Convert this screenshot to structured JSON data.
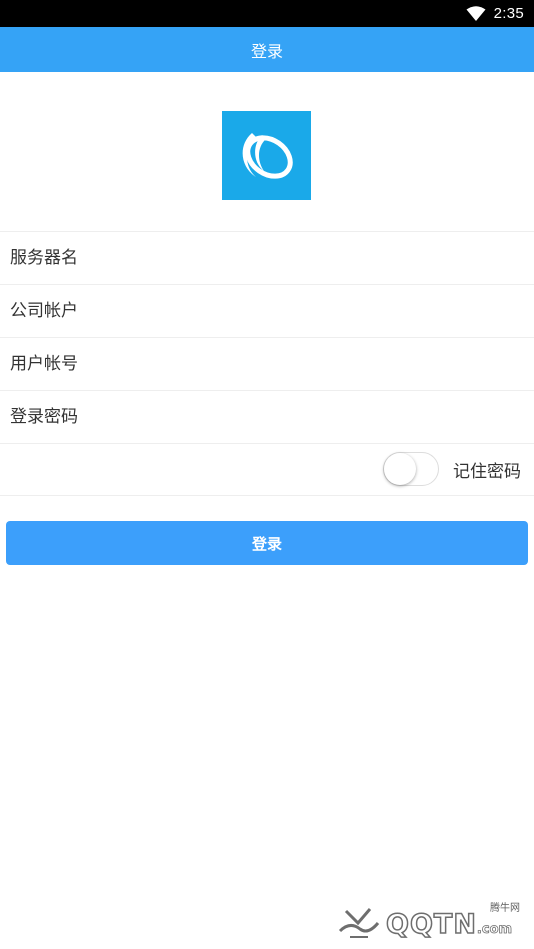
{
  "status_bar": {
    "time": "2:35"
  },
  "title_bar": {
    "title": "登录"
  },
  "form": {
    "server_placeholder": "服务器名",
    "company_placeholder": "公司帐户",
    "user_placeholder": "用户帐号",
    "password_placeholder": "登录密码",
    "remember_label": "记住密码",
    "remember_on": false
  },
  "login_button": {
    "label": "登录"
  },
  "colors": {
    "accent": "#35a3f6",
    "button": "#3c9ffb",
    "logo_bg": "#1aa9e9"
  },
  "watermark": {
    "cn": "腾牛网",
    "en": "QQTN",
    "suffix": ".com"
  }
}
